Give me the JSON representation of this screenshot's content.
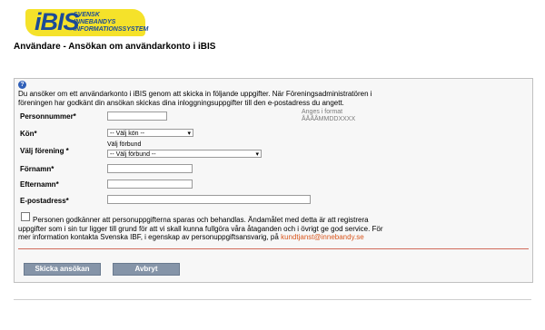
{
  "logo": {
    "main": "iBIS",
    "line1": "SVENSK",
    "line2": "INNEBANDYS",
    "line3": "INFORMATIONSSYSTEM"
  },
  "page_title": "Användare - Ansökan om användarkonto i iBIS",
  "info_icon": "info-icon",
  "intro_text": "Du ansöker om ett användarkonto i iBIS genom att skicka in följande uppgifter. När Föreningsadministratören i föreningen har godkänt din ansökan skickas dina inloggningsuppgifter till den e-postadress du angett.",
  "form": {
    "personnummer": {
      "label": "Personnummer*",
      "value": "",
      "hint_title": "Anges i format",
      "hint_format": "ÅÅÅÅMMDDXXXX"
    },
    "kon": {
      "label": "Kön*",
      "selected": "-- Välj kön --"
    },
    "forening": {
      "label": "Välj förening *",
      "forbund_label": "Välj förbund",
      "forbund_selected": "-- Välj förbund --"
    },
    "fornamn": {
      "label": "Förnamn*",
      "value": ""
    },
    "efternamn": {
      "label": "Efternamn*",
      "value": ""
    },
    "epost": {
      "label": "E-postadress*",
      "value": ""
    }
  },
  "consent": {
    "checked": false,
    "text": "Personen godkänner att personuppgifterna sparas och behandlas. Ändamålet med detta är att registrera uppgifter som i sin tur ligger till grund för att vi skall kunna fullgöra våra åtaganden och i övrigt ge god service. För mer information kontakta Svenska IBF, i egenskap av personuppgiftsansvarig, på",
    "email_link": "kundtjanst@innebandy.se"
  },
  "buttons": {
    "submit": "Skicka ansökan",
    "cancel": "Avbryt"
  },
  "colors": {
    "logo_bg": "#f5e22a",
    "logo_text": "#1c4b97",
    "button_bg": "#8594a8",
    "link": "#d9561d"
  }
}
